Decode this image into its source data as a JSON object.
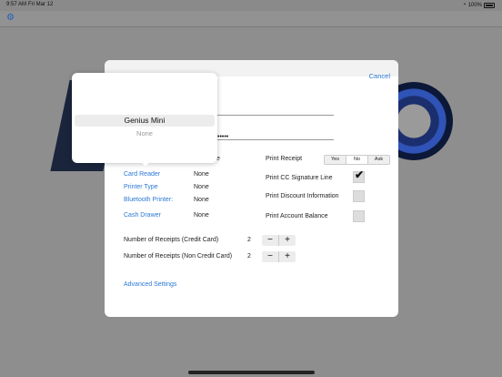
{
  "status_bar": {
    "time": "9:57 AM",
    "date": "Fri Mar 12",
    "battery": "100%"
  },
  "icons": {
    "settings": "gear-icon",
    "wifi": "wifi-icon",
    "battery": "battery-icon"
  },
  "modal": {
    "cancel_label": "Cancel",
    "password_dots": "•••••",
    "left_rows": [
      {
        "label": "Card Reader",
        "value": "None"
      },
      {
        "label": "Printer Type",
        "value": "None"
      },
      {
        "label": "Bluetooth Printer:",
        "value": "None"
      },
      {
        "label": "Cash Drawer",
        "value": "None"
      }
    ],
    "right_rows": {
      "print_receipt": "Print Receipt",
      "segments": [
        "Yes",
        "No",
        "Ask"
      ],
      "selected_segment": "No",
      "cc_signature": "Print CC Signature Line",
      "cc_signature_checked": true,
      "discount_info": "Print Discount Information",
      "discount_checked": false,
      "account_balance": "Print Account Balance",
      "balance_checked": false
    },
    "receipts_cc_label": "Number of Receipts (Credit Card)",
    "receipts_cc_value": "2",
    "receipts_noncc_label": "Number of Receipts (Non Credit Card)",
    "receipts_noncc_value": "2",
    "stepper_minus": "−",
    "stepper_plus": "+",
    "advanced_label": "Advanced Settings"
  },
  "picker": {
    "selected": "Genius Mini",
    "options": [
      "None"
    ]
  },
  "colors": {
    "accent": "#2a78d6",
    "backdrop": "#8e8e8e"
  }
}
